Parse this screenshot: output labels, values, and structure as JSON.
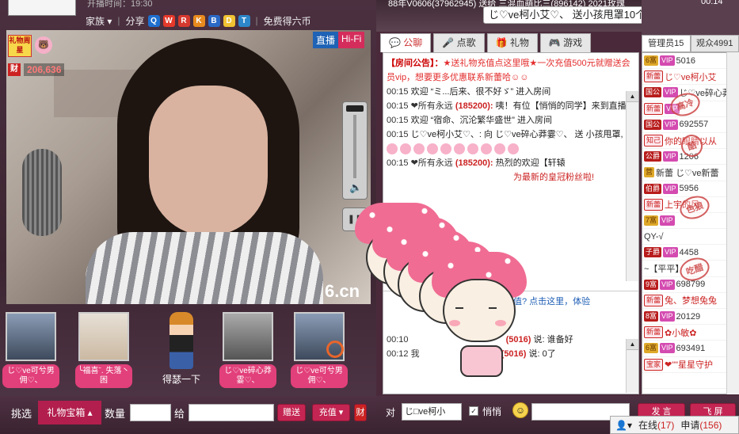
{
  "header": {
    "open_time": "开播时间：19:30",
    "room_info": "88年V0606(37962945) 送给 三混血萌比三(896142) 2021玫瑰",
    "clock": "00:14"
  },
  "topnav": {
    "family": "家族",
    "share": "分享",
    "free_coins": "免费得六币"
  },
  "video": {
    "live_tag": "直播",
    "hifi_tag": "Hi-Fi",
    "badge_weekstar": "礼物周星",
    "wealth_char": "财",
    "wealth_value": "206,636",
    "watermark": "6.cn"
  },
  "seats": [
    {
      "name": "じ♡ve可兮男佣♡、",
      "icon": "avatar"
    },
    {
      "name": "╰福喜ˉ. 失落丶困",
      "icon": "avatar"
    },
    {
      "name": "得瑟一下",
      "icon": "avatar-figure"
    },
    {
      "name": "じ♡ve碎心莽霎♡、",
      "icon": "avatar"
    },
    {
      "name": "じ♡ve可兮男佣♡、",
      "icon": "avatar"
    }
  ],
  "bottom_bar": {
    "select_label": "挑选",
    "gift_box": "礼物宝箱",
    "quantity_label": "数量",
    "to_label": "给",
    "give_button": "赠送",
    "recharge_button": "充值",
    "wealth_char": "财"
  },
  "gift_ticker": "じ♡ve柯小艾♡、 送小孩甩罩10个",
  "chat_tabs": [
    {
      "label": "公聊",
      "active": true
    },
    {
      "label": "点歌",
      "active": false
    },
    {
      "label": "礼物",
      "active": false
    },
    {
      "label": "游戏",
      "active": false
    }
  ],
  "chat": {
    "notice_title": "【房间公告】：",
    "notice_text": "★送礼物充值点这里哦★一次充值500元就赠送会员vip，想要更多优惠联系新蕾哈☺☺",
    "messages": [
      {
        "time": "00:15",
        "text": "欢迎 “ミ...后来、很不好ゞ” 进入房间"
      },
      {
        "time": "00:15",
        "user": "❤所有永远",
        "id": "(185200):",
        "text": "咦！有位【悄悄的同学】来到直播间"
      },
      {
        "time": "00:15",
        "text": "欢迎 “宿命、沉沦繁华盛世” 进入房间"
      },
      {
        "time": "00:15",
        "text": "じ♡ve柯小艾♡、: 向 じ♡ve碎心莽霎♡、 送 小孩甩罩,"
      },
      {
        "time": "00:15",
        "user": "❤所有永远",
        "id": "(185200):",
        "text": "热烈的欢迎【轩辕"
      },
      {
        "time": "",
        "text": "为最新的皇冠粉丝啦!"
      }
    ],
    "lower": [
      {
        "time": "",
        "text": "值? 点击这里，体验"
      },
      {
        "time": "00:10",
        "id": "(5016)",
        "text": "说: 谁备好"
      },
      {
        "time": "00:12",
        "user": "我",
        "id": "(5016)",
        "text": "说: 0了"
      }
    ]
  },
  "input_bar": {
    "to_label": "对",
    "to_value": "じ□ve柯小",
    "whisper_label": "悄悄",
    "send_button": "发 言",
    "fly_button": "飞 屏"
  },
  "right_tabs": [
    {
      "label": "管理员15",
      "active": true
    },
    {
      "label": "观众4991",
      "active": false
    }
  ],
  "users": [
    {
      "rank": "6富",
      "rank_class": "gold",
      "vip": "VIP",
      "name": "5016"
    },
    {
      "rank": "新蕾",
      "rank_class": "new",
      "vip": "",
      "name": "じ♡ve柯小艾"
    },
    {
      "rank": "国公",
      "rank_class": "",
      "vip": "VIP",
      "name": "じ♡ve碎心莽"
    },
    {
      "rank": "新蕾",
      "rank_class": "new",
      "vip": "VIP",
      "name": "ˇ"
    },
    {
      "rank": "国公",
      "rank_class": "",
      "vip": "VIP",
      "name": "692557"
    },
    {
      "rank": "知己",
      "rank_class": "new",
      "vip": "",
      "name": "你的眼睛以从"
    },
    {
      "rank": "公爵",
      "rank_class": "",
      "vip": "VIP",
      "name": "1206"
    },
    {
      "rank": "营",
      "rank_class": "gold",
      "vip": "",
      "name": "新蕾 じ♡ve新蕾"
    },
    {
      "rank": "伯爵",
      "rank_class": "",
      "vip": "VIP",
      "name": "5956"
    },
    {
      "rank": "新蕾",
      "rank_class": "new",
      "vip": "",
      "name": "上宇的风"
    },
    {
      "rank": "7富",
      "rank_class": "gold",
      "vip": "VIP",
      "name": ""
    },
    {
      "rank": "",
      "rank_class": "",
      "vip": "",
      "name": "QY-√"
    },
    {
      "rank": "子爵",
      "rank_class": "",
      "vip": "VIP",
      "name": "4458"
    },
    {
      "rank": "",
      "rank_class": "",
      "vip": "",
      "name": "~【平平】"
    },
    {
      "rank": "9富",
      "rank_class": "",
      "vip": "VIP",
      "name": "698799"
    },
    {
      "rank": "新蕾",
      "rank_class": "new",
      "vip": "",
      "name": "兔、梦想兔兔"
    },
    {
      "rank": "8富",
      "rank_class": "",
      "vip": "VIP",
      "name": "20129"
    },
    {
      "rank": "新蕾",
      "rank_class": "new",
      "vip": "",
      "name": "✿小敏✿"
    },
    {
      "rank": "6富",
      "rank_class": "gold",
      "vip": "VIP",
      "name": "693491"
    },
    {
      "rank": "宝家",
      "rank_class": "new",
      "vip": "",
      "name": "❤\"\"星星守护"
    },
    {
      "rank": "",
      "rank_class": "",
      "vip": "",
      "name": ""
    }
  ],
  "stamps": [
    "高冷",
    "酷",
    "色狼",
    "吃醋"
  ],
  "user_footer": {
    "online_label": "在线",
    "online_count": "(17)",
    "apply_label": "申请",
    "apply_count": "(156)"
  }
}
